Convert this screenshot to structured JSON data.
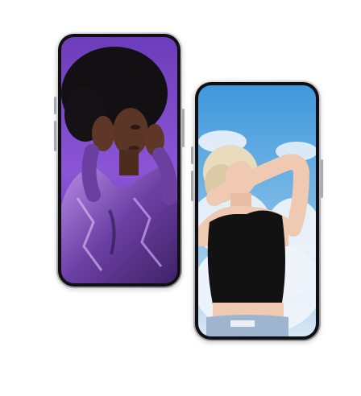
{
  "scene": {
    "background_color": "#ffffff",
    "phones": [
      {
        "id": "phone-purple",
        "screen_colors": {
          "background": "#7b48c9",
          "accent": "#b27be8",
          "hair": "#141014",
          "skin": "#5a3424",
          "jacket": "#6a3fa0"
        }
      },
      {
        "id": "phone-sky",
        "screen_colors": {
          "sky": "#4fa4e0",
          "cloud": "#eef4fb",
          "hair": "#e9dcc0",
          "skin": "#efc9b2",
          "top": "#121212",
          "jeans": "#9fb4cf"
        }
      }
    ]
  }
}
